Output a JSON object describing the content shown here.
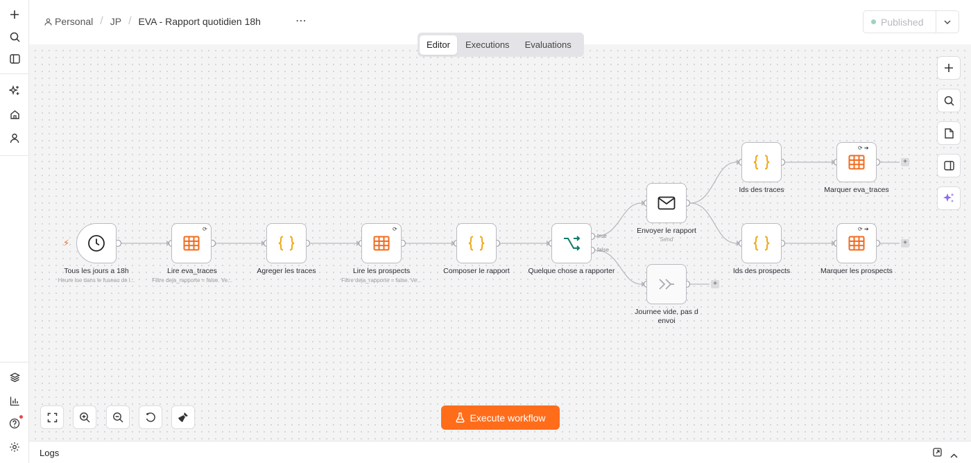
{
  "breadcrumb": {
    "owner": "Personal",
    "folder": "JP",
    "title": "EVA - Rapport quotidien 18h",
    "more": "⋯"
  },
  "publish": {
    "label": "Published"
  },
  "tabs": [
    {
      "label": "Editor"
    },
    {
      "label": "Executions"
    },
    {
      "label": "Evaluations"
    }
  ],
  "nodes": [
    {
      "label": "Tous les jours a 18h",
      "sub": "Heure lue dans le fuseau de l...",
      "icon": "clock-icon"
    },
    {
      "label": "Lire eva_traces",
      "sub": "Filtre deja_rapporte = false. Ve...",
      "icon": "table-icon"
    },
    {
      "label": "Agreger les traces",
      "icon": "braces-icon"
    },
    {
      "label": "Lire les prospects",
      "sub": "Filtre deja_rapporte = false. Ve...",
      "icon": "table-icon"
    },
    {
      "label": "Composer le rapport",
      "icon": "braces-icon"
    },
    {
      "label": "Quelque chose a rapporter",
      "icon": "branch-icon",
      "ports": [
        "true",
        "false"
      ]
    },
    {
      "label": "Envoyer le rapport",
      "sub": "Send",
      "icon": "mail-icon"
    },
    {
      "label": "Journee vide, pas d envoi",
      "icon": "noop-icon"
    },
    {
      "label": "Ids des traces",
      "icon": "braces-icon"
    },
    {
      "label": "Ids des prospects",
      "icon": "braces-icon"
    },
    {
      "label": "Marquer eva_traces",
      "icon": "table-icon"
    },
    {
      "label": "Marquer les prospects",
      "icon": "table-icon"
    }
  ],
  "plus": "+",
  "execute": {
    "label": "Execute workflow"
  },
  "logs": {
    "title": "Logs"
  },
  "colors": {
    "accent": "#ff6d1b",
    "table": "#f26b1d",
    "code": "#f0a818",
    "branch": "#0f7a6a",
    "published_dot": "#9ed2c4"
  }
}
